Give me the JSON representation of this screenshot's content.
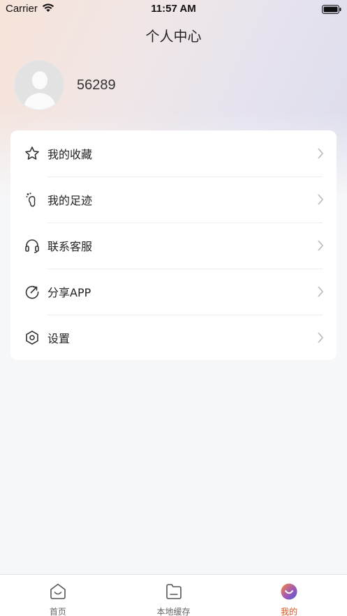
{
  "status_bar": {
    "carrier": "Carrier",
    "time": "11:57 AM"
  },
  "header": {
    "title": "个人中心"
  },
  "profile": {
    "user_id": "56289"
  },
  "menu": {
    "items": [
      {
        "label": "我的收藏",
        "icon": "star-icon"
      },
      {
        "label": "我的足迹",
        "icon": "footprint-icon"
      },
      {
        "label": "联系客服",
        "icon": "headset-icon"
      },
      {
        "label": "分享APP",
        "icon": "share-icon"
      },
      {
        "label": "设置",
        "icon": "settings-icon"
      }
    ]
  },
  "tabbar": {
    "tabs": [
      {
        "label": "首页",
        "icon": "home-icon",
        "active": false
      },
      {
        "label": "本地缓存",
        "icon": "folder-icon",
        "active": false
      },
      {
        "label": "我的",
        "icon": "profile-icon",
        "active": true
      }
    ]
  },
  "colors": {
    "accent": "#e0531f",
    "background": "#f6f7f9",
    "card": "#ffffff"
  }
}
